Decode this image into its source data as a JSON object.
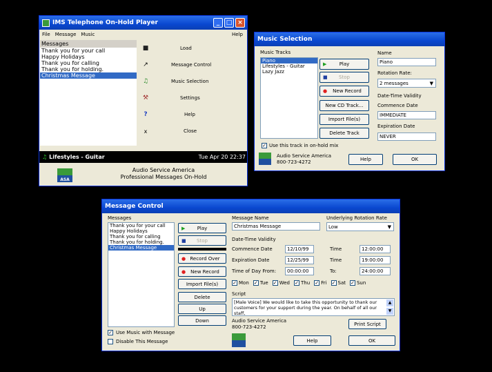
{
  "player": {
    "title": "IMS Telephone On-Hold Player",
    "menu": [
      "File",
      "Message",
      "Music"
    ],
    "menu_help": "Help",
    "list_header": "Messages",
    "messages": [
      "Thank you for your call",
      "Happy Holidays",
      "Thank you for calling",
      "Thank you for holding.",
      "Christmas Message"
    ],
    "buttons": [
      "Load",
      "Message Control",
      "Music Selection",
      "Settings",
      "Help",
      "Close"
    ],
    "now_playing": "Lifestyles - Guitar",
    "clock": "Tue Apr 20 22:37",
    "company": "Audio Service America",
    "tagline": "Professional Messages On-Hold",
    "logo": "ASA"
  },
  "music": {
    "title": "Music Selection",
    "tracks_label": "Music Tracks",
    "tracks": [
      "Piano",
      "Lifestyles - Guitar",
      "Lazy Jazz"
    ],
    "play": "Play",
    "stop": "Stop",
    "new_record": "New Record",
    "new_cd": "New CD Track...",
    "import": "Import File(s)",
    "delete": "Delete Track",
    "use_track": "Use this track in on-hold mix",
    "name_label": "Name",
    "name_value": "Piano",
    "rotation_label": "Rotation Rate:",
    "rotation_value": "2 messages",
    "validity_label": "Date-Time Validity",
    "commence_label": "Commence Date",
    "commence_value": "IMMEDIATE",
    "expiration_label": "Expiration Date",
    "expiration_value": "NEVER",
    "company": "Audio Service America",
    "phone": "800-723-4272",
    "help": "Help",
    "ok": "OK"
  },
  "msgctl": {
    "title": "Message Control",
    "messages_label": "Messages",
    "messages": [
      "Thank you for your call",
      "Happy Holidays",
      "Thank you for calling",
      "Thank you for holding.",
      "Christmas Message"
    ],
    "play": "Play",
    "stop": "Stop",
    "record_over": "Record Over",
    "new_record": "New Record",
    "import": "Import File(s)",
    "delete": "Delete",
    "up": "Up",
    "down": "Down",
    "use_music": "Use Music with Message",
    "disable": "Disable This Message",
    "name_label": "Message Name",
    "name_value": "Christmas Message",
    "rotation_label": "Underlying Rotation Rate",
    "rotation_value": "Low",
    "validity_label": "Date-Time Validity",
    "commence_label": "Commence Date",
    "commence_value": "12/10/99",
    "time_label": "Time",
    "commence_time": "12:00:00",
    "expiration_label": "Expiration Date",
    "expiration_value": "12/25/99",
    "expiration_time": "19:00:00",
    "tod_from_label": "Time of Day From:",
    "tod_from": "00:00:00",
    "to_label": "To:",
    "tod_to": "24:00:00",
    "days": [
      "Mon",
      "Tue",
      "Wed",
      "Thu",
      "Fri",
      "Sat",
      "Sun"
    ],
    "script_label": "Script",
    "script": "[Male Voice] We would like to take this opportunity to thank our customers for your support during the year. On behalf of all our staff,",
    "company": "Audio Service America",
    "phone": "800-723-4272",
    "print_script": "Print Script",
    "help": "Help",
    "ok": "OK"
  }
}
